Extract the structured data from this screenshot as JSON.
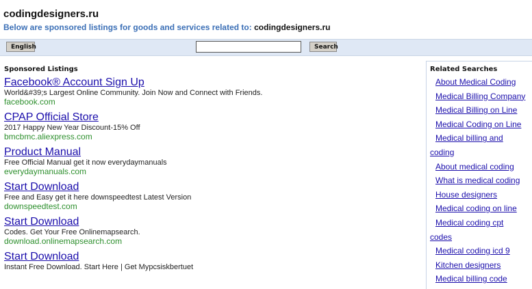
{
  "header": {
    "site_title": "codingdesigners.ru",
    "subtitle_prefix": "Below are sponsored listings for goods and services related to:",
    "subtitle_domain": "codingdesigners.ru"
  },
  "toolbar": {
    "language_label": "English",
    "search_value": "",
    "search_label": "Search"
  },
  "sponsored": {
    "heading": "Sponsored Listings",
    "listings": [
      {
        "title": "Facebook® Account Sign Up",
        "desc": "World&#39;s Largest Online Community. Join Now and Connect with Friends.",
        "url": "facebook.com"
      },
      {
        "title": "CPAP Official Store",
        "desc": "2017 Happy New Year Discount-15% Off",
        "url": "bmcbmc.aliexpress.com"
      },
      {
        "title": "Product Manual",
        "desc": "Free Official Manual get it now everydaymanuals",
        "url": "everydaymanuals.com"
      },
      {
        "title": "Start Download",
        "desc": "Free and Easy get it here downspeedtest Latest Version",
        "url": "downspeedtest.com"
      },
      {
        "title": "Start Download",
        "desc": "Codes. Get Your Free Onlinemapsearch.",
        "url": "download.onlinemapsearch.com"
      },
      {
        "title": "Start Download",
        "desc": "Instant Free Download. Start Here | Get Mypcsiskbertuet",
        "url": ""
      }
    ]
  },
  "related": {
    "heading": "Related Searches",
    "items": [
      [
        "About Medical Coding"
      ],
      [
        "Medical Billing Company"
      ],
      [
        "Medical Billing on Line"
      ],
      [
        "Medical Coding on Line"
      ],
      [
        "Medical billing and",
        "coding"
      ],
      [
        "About medical coding"
      ],
      [
        "What is medical coding"
      ],
      [
        "House designers"
      ],
      [
        "Medical coding on line"
      ],
      [
        "Medical coding cpt",
        "codes"
      ],
      [
        "Medical coding icd 9"
      ],
      [
        "Kitchen designers"
      ],
      [
        "Medical billing code"
      ]
    ]
  }
}
